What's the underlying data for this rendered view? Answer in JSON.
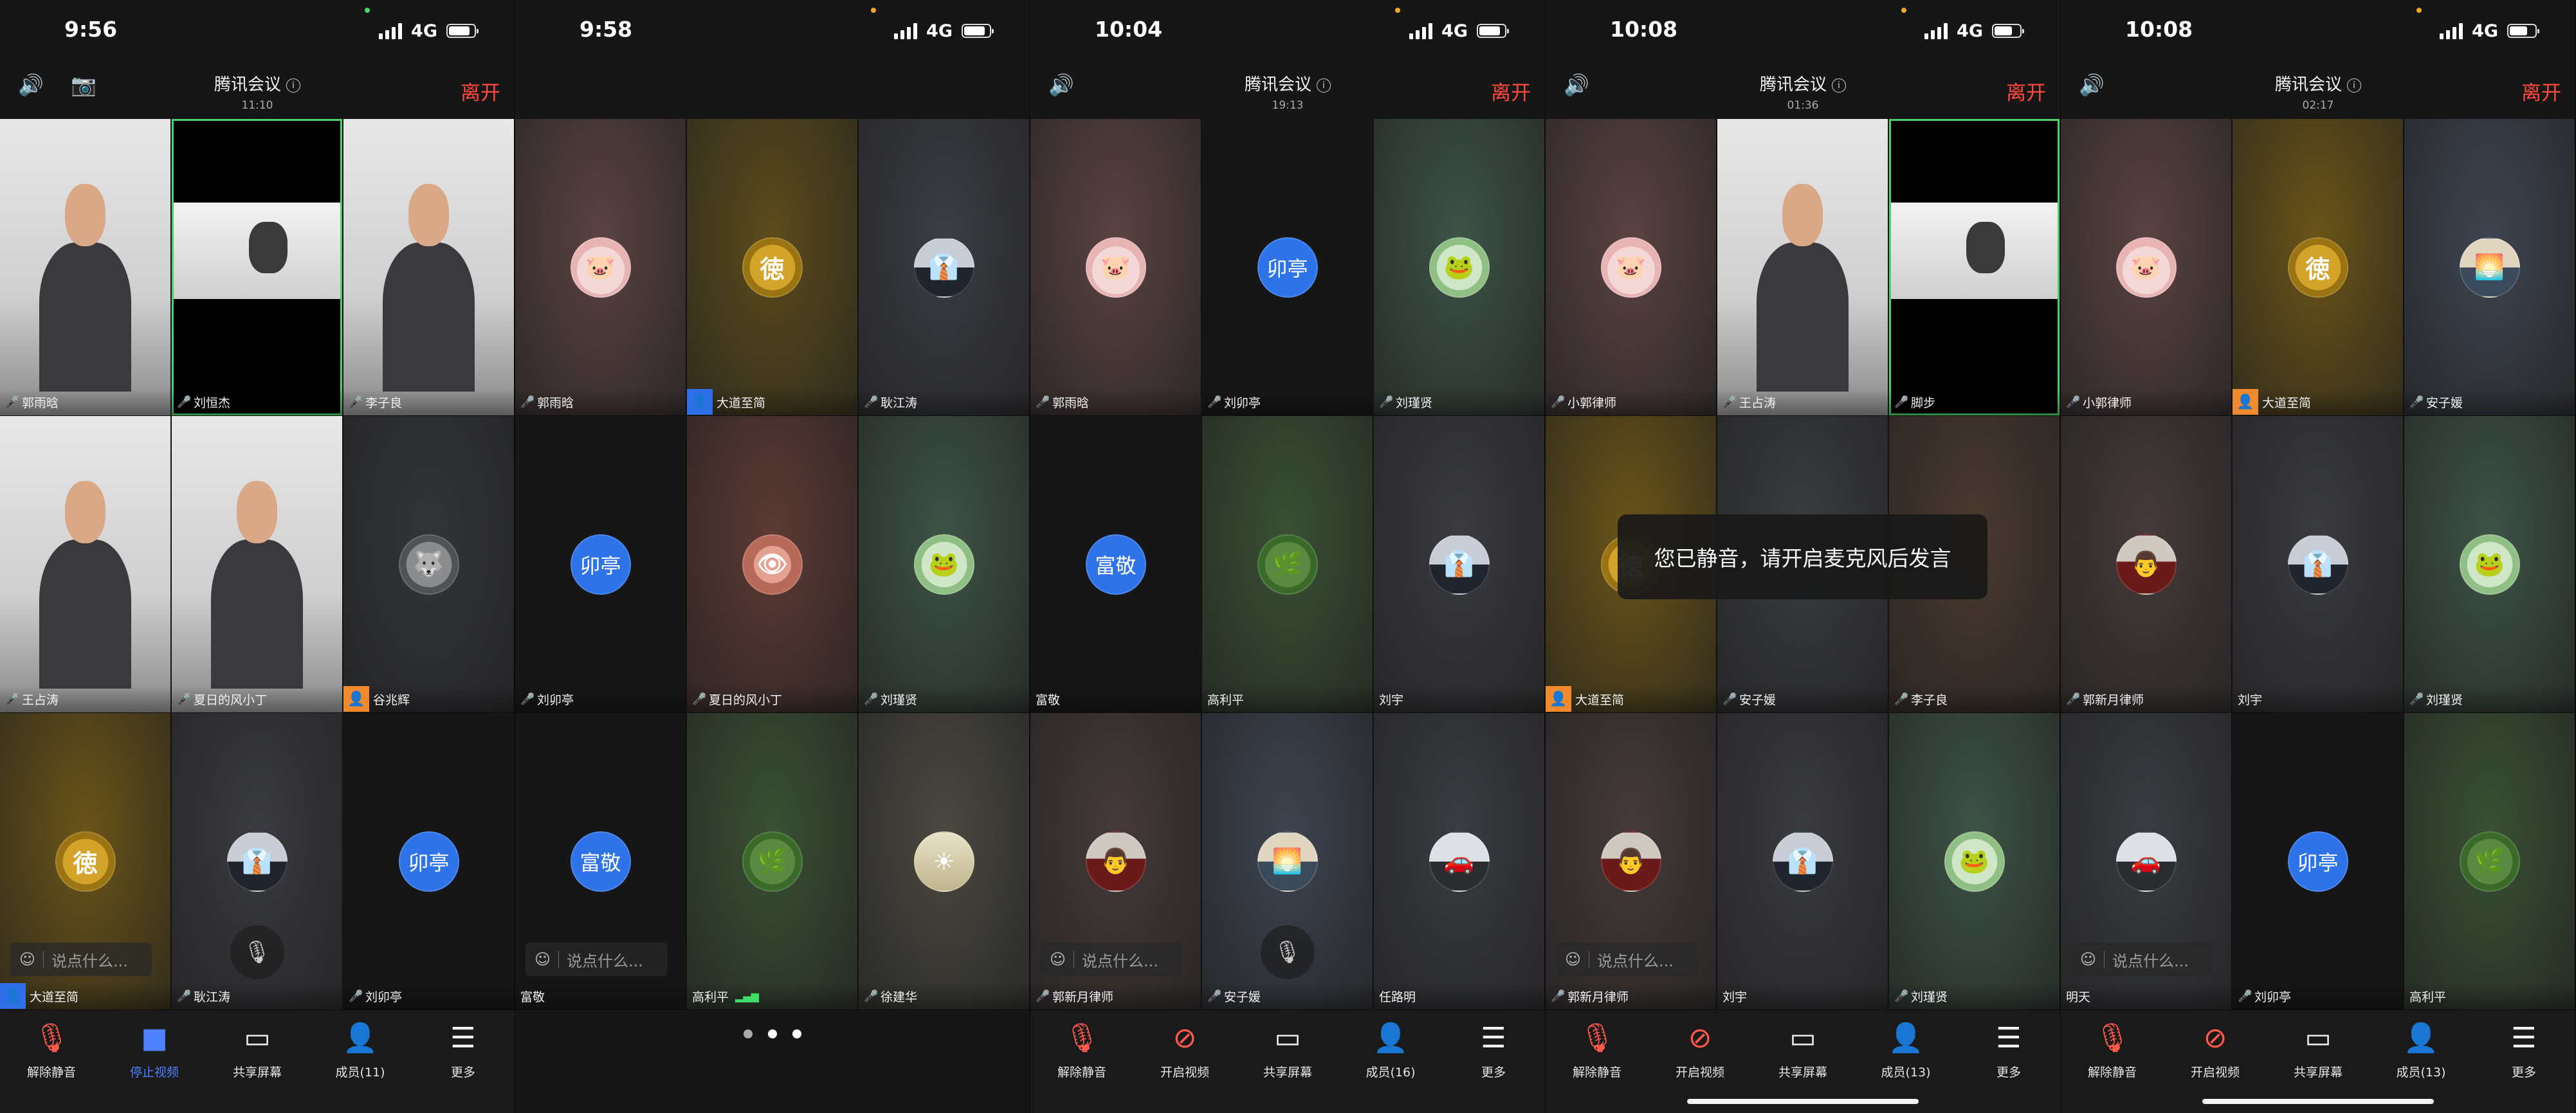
{
  "screens": [
    {
      "time": "9:56",
      "network": "4G",
      "header": {
        "title": "腾讯会议",
        "duration": "11:10",
        "leave_label": "离开",
        "has_camera_switch": true
      },
      "tiles": [
        {
          "name": "郭雨晗",
          "bg": "video",
          "mic": "active"
        },
        {
          "name": "刘恒杰",
          "bg": "video",
          "mic": "active",
          "active_speaker": true
        },
        {
          "name": "李子良",
          "bg": "video",
          "mic": "on"
        },
        {
          "name": "王占涛",
          "bg": "video",
          "mic": "active"
        },
        {
          "name": "夏日的风小丁",
          "bg": "video",
          "mic": "active"
        },
        {
          "name": "谷兆辉",
          "bg": "#33353a",
          "avatar": "wolf",
          "badge": "orange"
        },
        {
          "name": "大道至简",
          "bg": "#6a5418",
          "avatar": "coin",
          "badge": "blue"
        },
        {
          "name": "耿江涛",
          "bg": "#3a3b40",
          "avatar": "suit",
          "mic": "active",
          "mute_float": true
        },
        {
          "name": "刘卯亭",
          "bg": "#161616",
          "avatar_text": "卯亭",
          "mic": "on"
        }
      ],
      "chat_placeholder": "说点什么...",
      "toolbar": [
        {
          "label": "解除静音",
          "icon": "mic-off-icon"
        },
        {
          "label": "停止视频",
          "icon": "video-icon",
          "active": true
        },
        {
          "label": "共享屏幕",
          "icon": "screen-share-icon"
        },
        {
          "label": "成员(11)",
          "icon": "members-icon"
        },
        {
          "label": "更多",
          "icon": "more-icon"
        }
      ]
    },
    {
      "time": "9:58",
      "network": "4G",
      "tiles": [
        {
          "name": "郭雨晗",
          "bg": "#5a4242",
          "avatar": "cat",
          "mic": "active"
        },
        {
          "name": "大道至简",
          "bg": "#5c4c1c",
          "avatar": "coin",
          "badge": "blue"
        },
        {
          "name": "耿江涛",
          "bg": "#3b3d44",
          "avatar": "suit",
          "mic": "active"
        },
        {
          "name": "刘卯亭",
          "bg": "#161616",
          "avatar_text": "卯亭",
          "mic": "on"
        },
        {
          "name": "夏日的风小丁",
          "bg": "#5c3a34",
          "avatar": "eye",
          "mic": "active"
        },
        {
          "name": "刘瑾贤",
          "bg": "#3e5346",
          "avatar": "frog",
          "mic": "active"
        },
        {
          "name": "富敬",
          "bg": "#161616",
          "avatar_text": "富敬"
        },
        {
          "name": "高利平",
          "bg": "#3a5034",
          "avatar": "lotus",
          "signal": true
        },
        {
          "name": "徐建华",
          "bg": "#4a4840",
          "avatar": "sunset",
          "mic": "active"
        }
      ],
      "chat_placeholder": "说点什么..."
    },
    {
      "time": "10:04",
      "network": "4G",
      "header": {
        "title": "腾讯会议",
        "duration": "19:13",
        "leave_label": "离开"
      },
      "tiles": [
        {
          "name": "郭雨晗",
          "bg": "#5a4242",
          "avatar": "cat",
          "mic": "active"
        },
        {
          "name": "刘卯亭",
          "bg": "#161616",
          "avatar_text": "卯亭",
          "mic": "on"
        },
        {
          "name": "刘瑾贤",
          "bg": "#3e5346",
          "avatar": "frog",
          "mic": "active"
        },
        {
          "name": "富敬",
          "bg": "#161616",
          "avatar_text": "富敬"
        },
        {
          "name": "高利平",
          "bg": "#3a5034",
          "avatar": "lotus"
        },
        {
          "name": "刘宇",
          "bg": "#3a3b40",
          "avatar": "suit"
        },
        {
          "name": "郭新月律师",
          "bg": "#463a3a",
          "avatar": "man",
          "mic": "active"
        },
        {
          "name": "安子媛",
          "bg": "#3e4450",
          "avatar": "beach",
          "mic": "active",
          "mute_float": true
        },
        {
          "name": "任路明",
          "bg": "#3a3c42",
          "avatar": "car"
        }
      ],
      "chat_placeholder": "说点什么...",
      "toolbar": [
        {
          "label": "解除静音",
          "icon": "mic-off-icon"
        },
        {
          "label": "开启视频",
          "icon": "video-off-icon"
        },
        {
          "label": "共享屏幕",
          "icon": "screen-share-icon"
        },
        {
          "label": "成员(16)",
          "icon": "members-icon"
        },
        {
          "label": "更多",
          "icon": "more-icon"
        }
      ]
    },
    {
      "time": "10:08",
      "network": "4G",
      "header": {
        "title": "腾讯会议",
        "duration": "01:36",
        "leave_label": "离开"
      },
      "tiles": [
        {
          "name": "小郭律师",
          "bg": "#5a4242",
          "avatar": "cat",
          "mic": "active"
        },
        {
          "name": "王占涛",
          "bg": "video",
          "mic": "active"
        },
        {
          "name": "脚步",
          "bg": "video",
          "mic": "active",
          "active_speaker": true
        },
        {
          "name": "大道至简",
          "bg": "#6a5418",
          "avatar": "coin",
          "badge": "orange"
        },
        {
          "name": "安子媛",
          "bg": "#3a3c40",
          "mic": "active"
        },
        {
          "name": "李子良",
          "bg": "#4a3a30",
          "mic": "active"
        },
        {
          "name": "郭新月律师",
          "bg": "#463a3a",
          "avatar": "man",
          "mic": "active"
        },
        {
          "name": "刘宇",
          "bg": "#3a3b40",
          "avatar": "suit"
        },
        {
          "name": "刘瑾贤",
          "bg": "#3e5346",
          "avatar": "frog",
          "mic": "active"
        }
      ],
      "toast": "您已静音，请开启麦克风后发言",
      "chat_placeholder": "说点什么...",
      "toolbar": [
        {
          "label": "解除静音",
          "icon": "mic-off-icon"
        },
        {
          "label": "开启视频",
          "icon": "video-off-icon"
        },
        {
          "label": "共享屏幕",
          "icon": "screen-share-icon"
        },
        {
          "label": "成员(13)",
          "icon": "members-icon"
        },
        {
          "label": "更多",
          "icon": "more-icon"
        }
      ]
    },
    {
      "time": "10:08",
      "network": "4G",
      "header": {
        "title": "腾讯会议",
        "duration": "02:17",
        "leave_label": "离开"
      },
      "tiles": [
        {
          "name": "小郭律师",
          "bg": "#5a4242",
          "avatar": "cat",
          "mic": "active"
        },
        {
          "name": "大道至简",
          "bg": "#6a5418",
          "avatar": "coin",
          "badge": "orange"
        },
        {
          "name": "安子媛",
          "bg": "#3e4450",
          "avatar": "beach",
          "mic": "active"
        },
        {
          "name": "郭新月律师",
          "bg": "#463a3a",
          "avatar": "man",
          "mic": "active"
        },
        {
          "name": "刘宇",
          "bg": "#3a3b40",
          "avatar": "suit"
        },
        {
          "name": "刘瑾贤",
          "bg": "#3e5346",
          "avatar": "frog",
          "mic": "active"
        },
        {
          "name": "明天",
          "bg": "#3a3c42",
          "avatar": "car"
        },
        {
          "name": "刘卯亭",
          "bg": "#161616",
          "avatar_text": "卯亭",
          "mic": "active"
        },
        {
          "name": "高利平",
          "bg": "#3a5034",
          "avatar": "lotus"
        }
      ],
      "chat_placeholder": "说点什么...",
      "toolbar": [
        {
          "label": "解除静音",
          "icon": "mic-off-icon"
        },
        {
          "label": "开启视频",
          "icon": "video-off-icon"
        },
        {
          "label": "共享屏幕",
          "icon": "screen-share-icon"
        },
        {
          "label": "成员(13)",
          "icon": "members-icon"
        },
        {
          "label": "更多",
          "icon": "more-icon"
        }
      ]
    }
  ]
}
